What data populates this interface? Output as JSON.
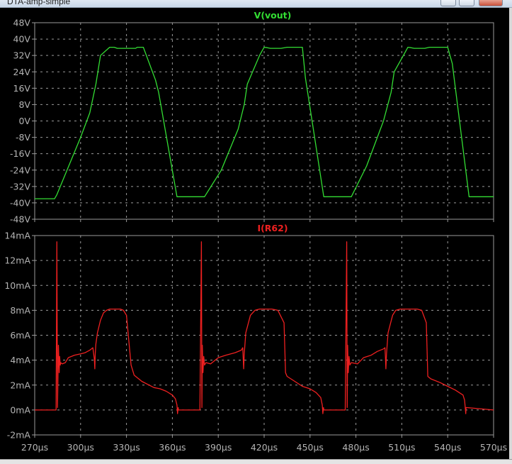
{
  "window": {
    "title": "DTA-amp-simple"
  },
  "colors": {
    "background": "#000000",
    "frame": "#9a9a9a",
    "grid": "#9a9a9a",
    "axis_text": "#b4b4b4",
    "vout": "#33dd33",
    "ir62": "#ee2020"
  },
  "chart_data": [
    {
      "type": "line",
      "title": "V(vout)",
      "xlabel": "",
      "ylabel": "",
      "xlim": [
        270,
        570
      ],
      "ylim": [
        -48,
        48
      ],
      "x_ticks": [
        270,
        300,
        330,
        360,
        390,
        420,
        450,
        480,
        510,
        540,
        570
      ],
      "x_tick_labels": [
        "270µs",
        "300µs",
        "330µs",
        "360µs",
        "390µs",
        "420µs",
        "450µs",
        "480µs",
        "510µs",
        "540µs",
        "570µs"
      ],
      "y_ticks": [
        48,
        40,
        32,
        24,
        16,
        8,
        0,
        -8,
        -16,
        -24,
        -32,
        -40,
        -48
      ],
      "y_tick_labels": [
        "48V",
        "40V",
        "32V",
        "24V",
        "16V",
        "8V",
        "0V",
        "-8V",
        "-16V",
        "-24V",
        "-32V",
        "-40V",
        "-48V"
      ],
      "grid": true,
      "series": [
        {
          "name": "V(vout)",
          "color": "#33dd33",
          "x": [
            270,
            283,
            284.5,
            300,
            306,
            310,
            313,
            319,
            322,
            324,
            326,
            336,
            337,
            341,
            349,
            351,
            363,
            379,
            381,
            392,
            403,
            407,
            409,
            417,
            420,
            422,
            424,
            431,
            435,
            445,
            447,
            459,
            475,
            477,
            487,
            498,
            503,
            505,
            511,
            514,
            516,
            518,
            525,
            528,
            540,
            543,
            554,
            568,
            570
          ],
          "y": [
            -38,
            -38,
            -36,
            -8,
            4,
            18,
            32,
            36,
            36,
            35.5,
            35.5,
            35.5,
            36,
            36,
            20,
            14,
            -37,
            -37,
            -37,
            -24,
            -4,
            8,
            18,
            32,
            36,
            35.8,
            35.5,
            35.5,
            36,
            36,
            21,
            -37,
            -37,
            -37,
            -22,
            0,
            14,
            24,
            32,
            36,
            35.8,
            35.5,
            35.5,
            36,
            36,
            28,
            -37,
            -37,
            -37
          ]
        }
      ]
    },
    {
      "type": "line",
      "title": "I(R62)",
      "xlabel": "",
      "ylabel": "",
      "xlim": [
        270,
        570
      ],
      "ylim": [
        -2,
        14
      ],
      "x_ticks": [
        270,
        300,
        330,
        360,
        390,
        420,
        450,
        480,
        510,
        540,
        570
      ],
      "x_tick_labels": [
        "270µs",
        "300µs",
        "330µs",
        "360µs",
        "390µs",
        "420µs",
        "450µs",
        "480µs",
        "510µs",
        "540µs",
        "570µs"
      ],
      "y_ticks": [
        14,
        12,
        10,
        8,
        6,
        4,
        2,
        0,
        -2
      ],
      "y_tick_labels": [
        "14mA",
        "12mA",
        "10mA",
        "8mA",
        "6mA",
        "4mA",
        "2mA",
        "0mA",
        "-2mA"
      ],
      "grid": true,
      "series": [
        {
          "name": "I(R62)",
          "color": "#ee2020",
          "x": [
            270,
            284,
            284.5,
            284.9,
            285.5,
            286,
            286.3,
            286.7,
            287,
            288,
            290,
            292,
            296,
            300,
            303,
            306,
            308,
            309,
            309.3,
            309.6,
            310,
            311,
            313,
            315,
            317,
            319,
            322,
            324,
            326,
            328,
            330,
            333,
            335,
            337,
            338,
            340,
            348,
            350,
            352,
            356,
            360,
            362,
            363,
            363.4,
            363.8,
            364,
            378,
            379,
            379.3,
            379.6,
            380,
            380.5,
            381,
            382,
            385,
            390,
            395,
            401,
            405,
            406,
            406.3,
            406.6,
            407,
            408,
            411,
            414,
            417,
            420,
            425,
            429,
            433,
            434,
            435,
            440,
            445,
            450,
            454,
            457,
            458,
            458.4,
            458.8,
            459,
            473,
            474,
            474.3,
            474.6,
            475,
            475.5,
            476,
            477,
            481,
            485,
            490,
            494,
            498,
            499,
            499.3,
            499.6,
            500,
            501,
            504,
            506,
            509,
            512,
            520,
            523,
            526,
            527,
            529,
            535,
            540,
            545,
            550,
            551,
            551.4,
            551.8,
            552,
            570
          ],
          "y": [
            0,
            0,
            13.5,
            0.2,
            5.2,
            3.0,
            4.3,
            3.6,
            3.8,
            3.7,
            3.8,
            4.2,
            4.4,
            4.5,
            4.6,
            4.8,
            5.0,
            4.1,
            3.3,
            4.5,
            5.3,
            6.2,
            7.2,
            7.8,
            8.0,
            8.1,
            8.1,
            8.1,
            8.1,
            8.0,
            7.6,
            3.6,
            2.8,
            2.6,
            2.5,
            2.3,
            1.8,
            1.75,
            1.7,
            1.5,
            1.2,
            0.9,
            0.4,
            -0.3,
            0.2,
            0,
            0,
            13.5,
            0.2,
            5.2,
            3.0,
            4.3,
            3.6,
            3.8,
            3.7,
            4.2,
            4.4,
            4.6,
            4.8,
            5.0,
            4.2,
            3.3,
            4.5,
            6.2,
            7.6,
            8.0,
            8.1,
            8.1,
            8.1,
            8.0,
            7.0,
            3.0,
            2.7,
            2.3,
            1.9,
            1.7,
            1.4,
            1.0,
            0.4,
            -0.3,
            0.2,
            0,
            0,
            13.5,
            0.2,
            5.2,
            3.0,
            4.3,
            3.6,
            3.8,
            3.7,
            4.2,
            4.4,
            4.7,
            4.9,
            5.0,
            4.2,
            3.3,
            4.5,
            6.2,
            7.6,
            8.0,
            8.1,
            8.1,
            8.1,
            8.0,
            7.0,
            2.7,
            2.5,
            2.2,
            1.9,
            1.6,
            1.2,
            0.8,
            0.3,
            -0.3,
            0.2,
            0
          ]
        }
      ]
    }
  ]
}
